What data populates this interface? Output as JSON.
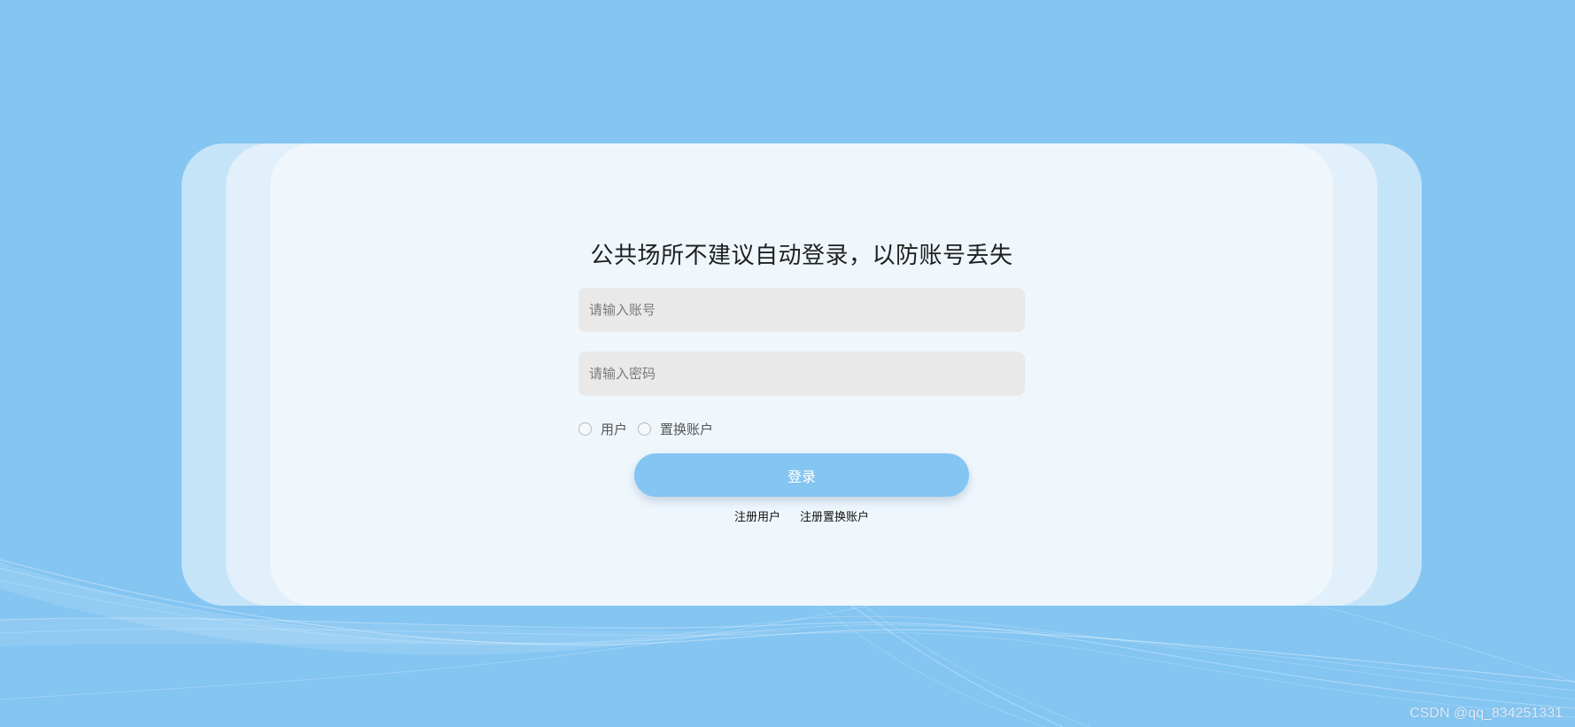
{
  "login": {
    "title": "公共场所不建议自动登录，以防账号丢失",
    "account_placeholder": "请输入账号",
    "password_placeholder": "请输入密码",
    "radio_options": [
      "用户",
      "置换账户"
    ],
    "login_label": "登录",
    "links": [
      "注册用户",
      "注册置换账户"
    ]
  },
  "watermark": "CSDN @qq_834251331",
  "colors": {
    "background": "#84c5f2",
    "card": "#eff7fd",
    "button": "#84c5f2"
  }
}
